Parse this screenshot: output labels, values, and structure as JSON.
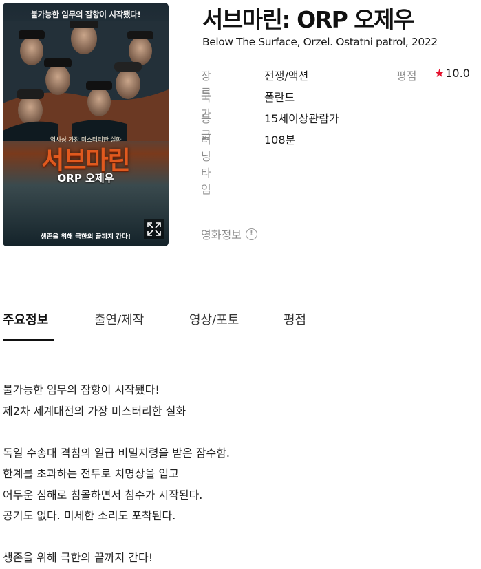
{
  "poster": {
    "tagline_top": "불가능한 임무의 잠항이 시작됐다!",
    "small_line": "역사상 가장 미스터리한 실화",
    "big_title": "서브마린",
    "sub_title": "ORP 오제우",
    "bottom_tagline": "생존을 위해 극한의 끝까지 간다!",
    "expand_icon": "expand-icon"
  },
  "movie": {
    "title": "서브마린: ORP 오제우",
    "original_title": "Below The Surface, Orzel. Ostatni patrol, 2022"
  },
  "meta": {
    "genre_label": "장르",
    "genre": "전쟁/액션",
    "country_label": "국가",
    "country": "폴란드",
    "grade_label": "등급",
    "grade": "15세이상관람가",
    "runtime_label": "러닝타임",
    "runtime": "108분"
  },
  "rating": {
    "label": "평점",
    "star_icon": "star-icon",
    "value": "10.0",
    "star_color": "#e5132f"
  },
  "movie_info": {
    "label": "영화정보",
    "icon": "info-icon"
  },
  "tabs": [
    {
      "label": "주요정보",
      "active": true
    },
    {
      "label": "출연/제작",
      "active": false
    },
    {
      "label": "영상/포토",
      "active": false
    },
    {
      "label": "평점",
      "active": false
    }
  ],
  "synopsis": [
    "불가능한 임무의 잠항이 시작됐다!",
    "제2차 세계대전의 가장 미스터리한 실화",
    "",
    "독일 수송대 격침의 일급 비밀지령을 받은 잠수함.",
    "한계를 초과하는 전투로 치명상을 입고",
    "어두운 심해로 침몰하면서 침수가 시작된다.",
    "공기도 없다. 미세한 소리도 포착된다.",
    "",
    "생존을 위해 극한의 끝까지 간다!"
  ]
}
